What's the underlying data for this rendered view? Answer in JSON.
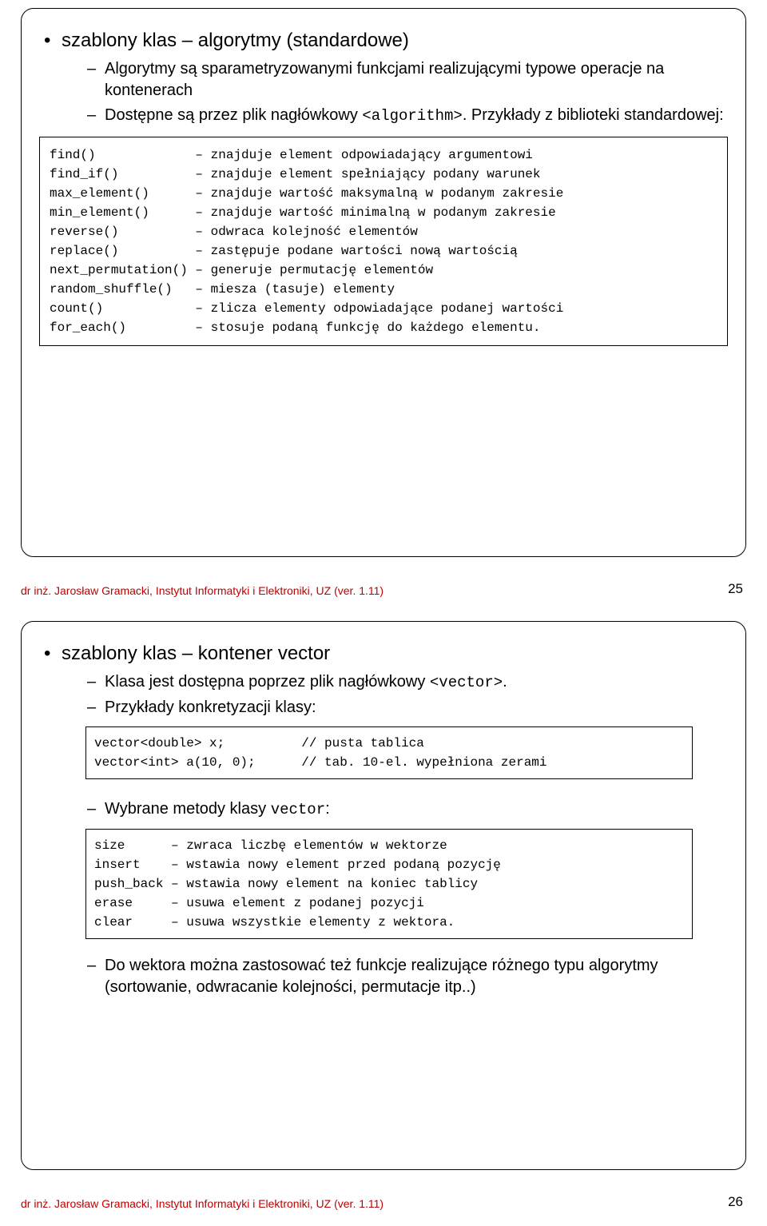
{
  "slide25": {
    "title": "szablony klas – algorytmy (standardowe)",
    "sub1": "Algorytmy są sparametryzowanymi funkcjami realizującymi typowe operacje na kontenerach",
    "sub2_a": "Dostępne są przez plik nagłówkowy ",
    "sub2_code": "<algorithm>",
    "sub2_b": ". Przykłady z biblioteki standardowej:",
    "code": "find()             – znajduje element odpowiadający argumentowi\nfind_if()          – znajduje element spełniający podany warunek\nmax_element()      – znajduje wartość maksymalną w podanym zakresie\nmin_element()      – znajduje wartość minimalną w podanym zakresie\nreverse()          – odwraca kolejność elementów\nreplace()          – zastępuje podane wartości nową wartością\nnext_permutation() – generuje permutację elementów\nrandom_shuffle()   – miesza (tasuje) elementy\ncount()            – zlicza elementy odpowiadające podanej wartości\nfor_each()         – stosuje podaną funkcję do każdego elementu.",
    "footer": "dr inż. Jarosław Gramacki, Instytut Informatyki i Elektroniki, UZ (ver. 1.11)",
    "page": "25"
  },
  "slide26": {
    "title": "szablony klas – kontener vector",
    "sub1_a": "Klasa jest dostępna poprzez plik nagłówkowy ",
    "sub1_code": "<vector>",
    "sub1_b": ".",
    "sub2": "Przykłady konkretyzacji klasy:",
    "code1": "vector<double> x;          // pusta tablica\nvector<int> a(10, 0);      // tab. 10-el. wypełniona zerami",
    "sub3_a": "Wybrane metody klasy ",
    "sub3_code": "vector",
    "sub3_b": ":",
    "code2": "size      – zwraca liczbę elementów w wektorze\ninsert    – wstawia nowy element przed podaną pozycję\npush_back – wstawia nowy element na koniec tablicy\nerase     – usuwa element z podanej pozycji\nclear     – usuwa wszystkie elementy z wektora.",
    "sub4": "Do wektora można zastosować też funkcje realizujące różnego typu algorytmy (sortowanie, odwracanie kolejności, permutacje itp..)",
    "footer": "dr inż. Jarosław Gramacki, Instytut Informatyki i Elektroniki, UZ (ver. 1.11)",
    "page": "26"
  }
}
